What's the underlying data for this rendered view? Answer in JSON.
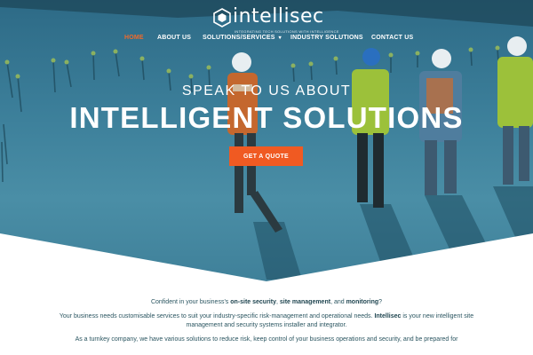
{
  "brand": {
    "name": "intellisec",
    "tagline": "INTEGRATING TECH SOLUTIONS WITH INTELLIGENCE",
    "logo_icon": "hexagon-logo-icon"
  },
  "nav": {
    "items": [
      {
        "label": "HOME",
        "active": true
      },
      {
        "label": "ABOUT US",
        "active": false
      },
      {
        "label": "SOLUTIONS/SERVICES",
        "active": false,
        "has_dropdown": true
      },
      {
        "label": "INDUSTRY SOLUTIONS",
        "active": false
      },
      {
        "label": "CONTACT US",
        "active": false
      }
    ],
    "dropdown_icon": "chevron-down-icon"
  },
  "hero": {
    "line1": "SPEAK TO US ABOUT",
    "line2": "INTELLIGENT SOLUTIONS",
    "cta_label": "GET A QUOTE"
  },
  "intro": {
    "p1_a": "Confident in your business's ",
    "p1_b": "on-site security",
    "p1_c": ", ",
    "p1_d": "site management",
    "p1_e": ", and ",
    "p1_f": "monitoring",
    "p1_g": "?",
    "p2_a": "Your business needs customisable services to suit your industry-specific risk-management  and operational needs. ",
    "p2_b": "Intellisec",
    "p2_c": " is your new intelligent site management and security systems installer and integrator.",
    "p3": "As a turnkey company, we have various solutions to reduce risk, keep control of your business operations and security, and be prepared for"
  },
  "colors": {
    "accent": "#f05a22",
    "nav_active": "#f06a2a",
    "hero_tint": "#3c7f9a",
    "body_text": "#2a5560"
  }
}
